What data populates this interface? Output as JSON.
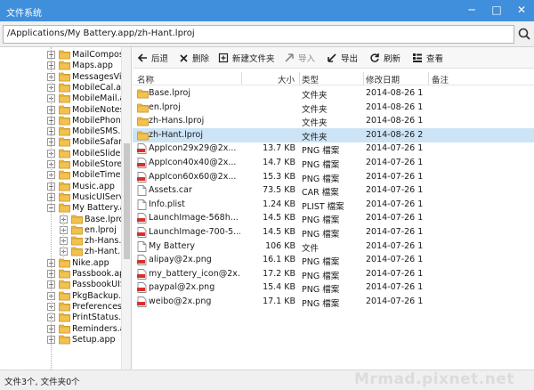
{
  "window": {
    "title": "文件系统",
    "minimize": "─",
    "maximize": "□",
    "close": "✕"
  },
  "address": {
    "path": "/Applications/My Battery.app/zh-Hant.lproj"
  },
  "toolbar": {
    "back": "后退",
    "delete": "删除",
    "new_folder": "新建文件夹",
    "import": "导入",
    "export": "导出",
    "refresh": "刷新",
    "view": "查看"
  },
  "columns": {
    "name": "名称",
    "size": "大小",
    "type": "类型",
    "modified": "修改日期",
    "notes": "备注"
  },
  "tree": [
    {
      "label": "MailCompos",
      "expanded": false,
      "folder": true
    },
    {
      "label": "Maps.app",
      "expanded": false,
      "folder": true
    },
    {
      "label": "MessagesVie",
      "expanded": false,
      "folder": true
    },
    {
      "label": "MobileCal.ap",
      "expanded": false,
      "folder": true
    },
    {
      "label": "MobileMail.a",
      "expanded": false,
      "folder": true
    },
    {
      "label": "MobileNotes",
      "expanded": false,
      "folder": true
    },
    {
      "label": "MobilePhone",
      "expanded": false,
      "folder": true
    },
    {
      "label": "MobileSMS.a",
      "expanded": false,
      "folder": true
    },
    {
      "label": "MobileSafari",
      "expanded": false,
      "folder": true
    },
    {
      "label": "MobileSlideS",
      "expanded": false,
      "folder": true
    },
    {
      "label": "MobileStore.",
      "expanded": false,
      "folder": true
    },
    {
      "label": "MobileTimer",
      "expanded": false,
      "folder": true
    },
    {
      "label": "Music.app",
      "expanded": false,
      "folder": true
    },
    {
      "label": "MusicUIServi",
      "expanded": false,
      "folder": true
    },
    {
      "label": "My Battery.ap",
      "expanded": true,
      "folder": true
    },
    {
      "label": "Base.lpro",
      "expanded": false,
      "folder": true,
      "child": true
    },
    {
      "label": "en.lproj",
      "expanded": false,
      "folder": true,
      "child": true
    },
    {
      "label": "zh-Hans.l",
      "expanded": false,
      "folder": true,
      "child": true
    },
    {
      "label": "zh-Hant.l",
      "expanded": false,
      "folder": true,
      "child": true
    },
    {
      "label": "Nike.app",
      "expanded": false,
      "folder": true
    },
    {
      "label": "Passbook.app",
      "expanded": false,
      "folder": true
    },
    {
      "label": "PassbookUIS",
      "expanded": false,
      "folder": true
    },
    {
      "label": "PkgBackup.a",
      "expanded": false,
      "folder": true
    },
    {
      "label": "Preferences.a",
      "expanded": false,
      "folder": true
    },
    {
      "label": "PrintStatus.ap",
      "expanded": false,
      "folder": true
    },
    {
      "label": "Reminders.ap",
      "expanded": false,
      "folder": true
    },
    {
      "label": "Setup.app",
      "expanded": false,
      "folder": true
    }
  ],
  "files": [
    {
      "name": "Base.lproj",
      "size": "",
      "type": "文件夹",
      "date": "2014-08-26 1",
      "icon": "folder"
    },
    {
      "name": "en.lproj",
      "size": "",
      "type": "文件夹",
      "date": "2014-08-26 1",
      "icon": "folder"
    },
    {
      "name": "zh-Hans.lproj",
      "size": "",
      "type": "文件夹",
      "date": "2014-08-26 1",
      "icon": "folder"
    },
    {
      "name": "zh-Hant.lproj",
      "size": "",
      "type": "文件夹",
      "date": "2014-08-26 2",
      "icon": "folder",
      "selected": true
    },
    {
      "name": "AppIcon29x29@2x...",
      "size": "13.7 KB",
      "type": "PNG 檔案",
      "date": "2014-07-26 1",
      "icon": "png"
    },
    {
      "name": "AppIcon40x40@2x...",
      "size": "14.7 KB",
      "type": "PNG 檔案",
      "date": "2014-07-26 1",
      "icon": "png"
    },
    {
      "name": "AppIcon60x60@2x...",
      "size": "15.3 KB",
      "type": "PNG 檔案",
      "date": "2014-07-26 1",
      "icon": "png"
    },
    {
      "name": "Assets.car",
      "size": "73.5 KB",
      "type": "CAR 檔案",
      "date": "2014-07-26 1",
      "icon": "doc"
    },
    {
      "name": "Info.plist",
      "size": "1.24 KB",
      "type": "PLIST 檔案",
      "date": "2014-07-26 1",
      "icon": "doc"
    },
    {
      "name": "LaunchImage-568h...",
      "size": "14.5 KB",
      "type": "PNG 檔案",
      "date": "2014-07-26 1",
      "icon": "png"
    },
    {
      "name": "LaunchImage-700-5...",
      "size": "14.5 KB",
      "type": "PNG 檔案",
      "date": "2014-07-26 1",
      "icon": "png"
    },
    {
      "name": "My Battery",
      "size": "106 KB",
      "type": "文件",
      "date": "2014-07-26 1",
      "icon": "doc"
    },
    {
      "name": "alipay@2x.png",
      "size": "16.1 KB",
      "type": "PNG 檔案",
      "date": "2014-07-26 1",
      "icon": "png"
    },
    {
      "name": "my_battery_icon@2x...",
      "size": "17.2 KB",
      "type": "PNG 檔案",
      "date": "2014-07-26 1",
      "icon": "png"
    },
    {
      "name": "paypal@2x.png",
      "size": "15.4 KB",
      "type": "PNG 檔案",
      "date": "2014-07-26 1",
      "icon": "png"
    },
    {
      "name": "weibo@2x.png",
      "size": "17.1 KB",
      "type": "PNG 檔案",
      "date": "2014-07-26 1",
      "icon": "png"
    }
  ],
  "status": {
    "text": "文件3个, 文件夹0个"
  },
  "watermark": "Mrmad.pixnet.net",
  "colors": {
    "titlebar": "#3f8fdc",
    "selection": "#cde4f7",
    "folder": "#f2c14e",
    "png_badge": "#d9302c"
  }
}
